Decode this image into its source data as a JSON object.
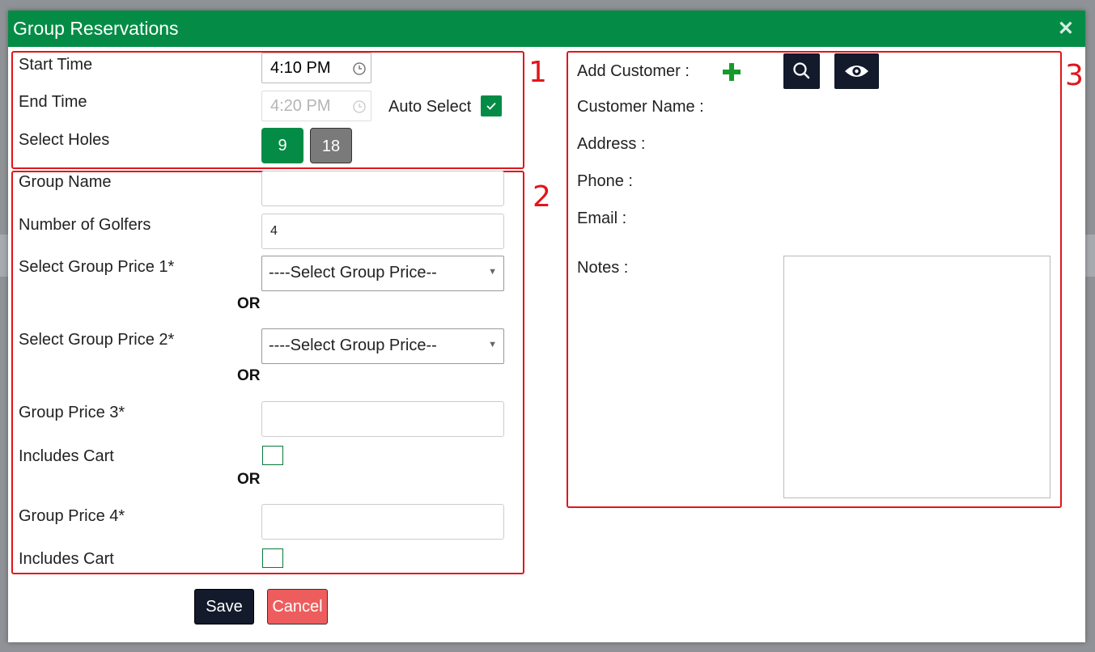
{
  "modal": {
    "title": "Group Reservations"
  },
  "annotations": {
    "box1": "1",
    "box2": "2",
    "box3": "3"
  },
  "time": {
    "start_label": "Start Time",
    "start_value": "4:10 PM",
    "end_label": "End Time",
    "end_value": "4:20 PM",
    "auto_select_label": "Auto Select",
    "auto_select_checked": true,
    "holes_label": "Select Holes",
    "holes_options": [
      "9",
      "18"
    ],
    "holes_selected": "9"
  },
  "group": {
    "name_label": "Group Name",
    "name_value": "",
    "golfers_label": "Number of Golfers",
    "golfers_value": "4",
    "price1_label": "Select Group Price 1*",
    "price1_selected": "----Select Group Price--",
    "or_label": "OR",
    "price2_label": "Select Group Price 2*",
    "price2_selected": "----Select Group Price--",
    "price3_label": "Group Price 3*",
    "price3_value": "",
    "includes_cart_label": "Includes Cart",
    "price4_label": "Group Price 4*",
    "price4_value": ""
  },
  "customer": {
    "add_label": "Add Customer :",
    "name_label": "Customer Name :",
    "address_label": "Address :",
    "phone_label": "Phone :",
    "email_label": "Email :",
    "notes_label": "Notes :",
    "icons": [
      "plus-icon",
      "search-icon",
      "eye-icon"
    ]
  },
  "actions": {
    "save_label": "Save",
    "cancel_label": "Cancel"
  },
  "colors": {
    "header": "#048c46",
    "accent_green": "#048c46",
    "annotation_red": "#e0161c",
    "dark_button": "#121a2b",
    "cancel_button": "#ee5d5d",
    "inactive_button": "#7a7a7a"
  }
}
